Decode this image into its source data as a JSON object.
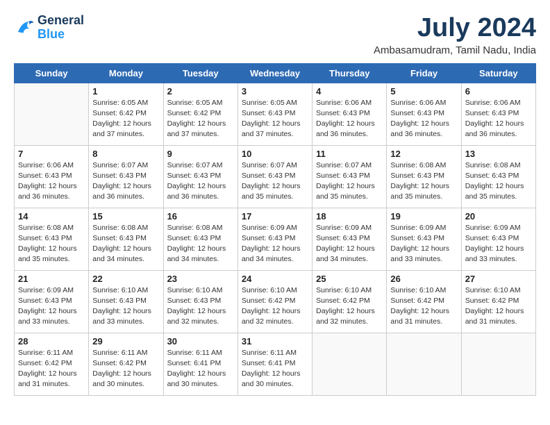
{
  "header": {
    "logo_line1": "General",
    "logo_line2": "Blue",
    "month_year": "July 2024",
    "location": "Ambasamudram, Tamil Nadu, India"
  },
  "weekdays": [
    "Sunday",
    "Monday",
    "Tuesday",
    "Wednesday",
    "Thursday",
    "Friday",
    "Saturday"
  ],
  "weeks": [
    [
      {
        "day": "",
        "info": ""
      },
      {
        "day": "1",
        "info": "Sunrise: 6:05 AM\nSunset: 6:42 PM\nDaylight: 12 hours\nand 37 minutes."
      },
      {
        "day": "2",
        "info": "Sunrise: 6:05 AM\nSunset: 6:42 PM\nDaylight: 12 hours\nand 37 minutes."
      },
      {
        "day": "3",
        "info": "Sunrise: 6:05 AM\nSunset: 6:43 PM\nDaylight: 12 hours\nand 37 minutes."
      },
      {
        "day": "4",
        "info": "Sunrise: 6:06 AM\nSunset: 6:43 PM\nDaylight: 12 hours\nand 36 minutes."
      },
      {
        "day": "5",
        "info": "Sunrise: 6:06 AM\nSunset: 6:43 PM\nDaylight: 12 hours\nand 36 minutes."
      },
      {
        "day": "6",
        "info": "Sunrise: 6:06 AM\nSunset: 6:43 PM\nDaylight: 12 hours\nand 36 minutes."
      }
    ],
    [
      {
        "day": "7",
        "info": "Sunrise: 6:06 AM\nSunset: 6:43 PM\nDaylight: 12 hours\nand 36 minutes."
      },
      {
        "day": "8",
        "info": "Sunrise: 6:07 AM\nSunset: 6:43 PM\nDaylight: 12 hours\nand 36 minutes."
      },
      {
        "day": "9",
        "info": "Sunrise: 6:07 AM\nSunset: 6:43 PM\nDaylight: 12 hours\nand 36 minutes."
      },
      {
        "day": "10",
        "info": "Sunrise: 6:07 AM\nSunset: 6:43 PM\nDaylight: 12 hours\nand 35 minutes."
      },
      {
        "day": "11",
        "info": "Sunrise: 6:07 AM\nSunset: 6:43 PM\nDaylight: 12 hours\nand 35 minutes."
      },
      {
        "day": "12",
        "info": "Sunrise: 6:08 AM\nSunset: 6:43 PM\nDaylight: 12 hours\nand 35 minutes."
      },
      {
        "day": "13",
        "info": "Sunrise: 6:08 AM\nSunset: 6:43 PM\nDaylight: 12 hours\nand 35 minutes."
      }
    ],
    [
      {
        "day": "14",
        "info": "Sunrise: 6:08 AM\nSunset: 6:43 PM\nDaylight: 12 hours\nand 35 minutes."
      },
      {
        "day": "15",
        "info": "Sunrise: 6:08 AM\nSunset: 6:43 PM\nDaylight: 12 hours\nand 34 minutes."
      },
      {
        "day": "16",
        "info": "Sunrise: 6:08 AM\nSunset: 6:43 PM\nDaylight: 12 hours\nand 34 minutes."
      },
      {
        "day": "17",
        "info": "Sunrise: 6:09 AM\nSunset: 6:43 PM\nDaylight: 12 hours\nand 34 minutes."
      },
      {
        "day": "18",
        "info": "Sunrise: 6:09 AM\nSunset: 6:43 PM\nDaylight: 12 hours\nand 34 minutes."
      },
      {
        "day": "19",
        "info": "Sunrise: 6:09 AM\nSunset: 6:43 PM\nDaylight: 12 hours\nand 33 minutes."
      },
      {
        "day": "20",
        "info": "Sunrise: 6:09 AM\nSunset: 6:43 PM\nDaylight: 12 hours\nand 33 minutes."
      }
    ],
    [
      {
        "day": "21",
        "info": "Sunrise: 6:09 AM\nSunset: 6:43 PM\nDaylight: 12 hours\nand 33 minutes."
      },
      {
        "day": "22",
        "info": "Sunrise: 6:10 AM\nSunset: 6:43 PM\nDaylight: 12 hours\nand 33 minutes."
      },
      {
        "day": "23",
        "info": "Sunrise: 6:10 AM\nSunset: 6:43 PM\nDaylight: 12 hours\nand 32 minutes."
      },
      {
        "day": "24",
        "info": "Sunrise: 6:10 AM\nSunset: 6:42 PM\nDaylight: 12 hours\nand 32 minutes."
      },
      {
        "day": "25",
        "info": "Sunrise: 6:10 AM\nSunset: 6:42 PM\nDaylight: 12 hours\nand 32 minutes."
      },
      {
        "day": "26",
        "info": "Sunrise: 6:10 AM\nSunset: 6:42 PM\nDaylight: 12 hours\nand 31 minutes."
      },
      {
        "day": "27",
        "info": "Sunrise: 6:10 AM\nSunset: 6:42 PM\nDaylight: 12 hours\nand 31 minutes."
      }
    ],
    [
      {
        "day": "28",
        "info": "Sunrise: 6:11 AM\nSunset: 6:42 PM\nDaylight: 12 hours\nand 31 minutes."
      },
      {
        "day": "29",
        "info": "Sunrise: 6:11 AM\nSunset: 6:42 PM\nDaylight: 12 hours\nand 30 minutes."
      },
      {
        "day": "30",
        "info": "Sunrise: 6:11 AM\nSunset: 6:41 PM\nDaylight: 12 hours\nand 30 minutes."
      },
      {
        "day": "31",
        "info": "Sunrise: 6:11 AM\nSunset: 6:41 PM\nDaylight: 12 hours\nand 30 minutes."
      },
      {
        "day": "",
        "info": ""
      },
      {
        "day": "",
        "info": ""
      },
      {
        "day": "",
        "info": ""
      }
    ]
  ]
}
